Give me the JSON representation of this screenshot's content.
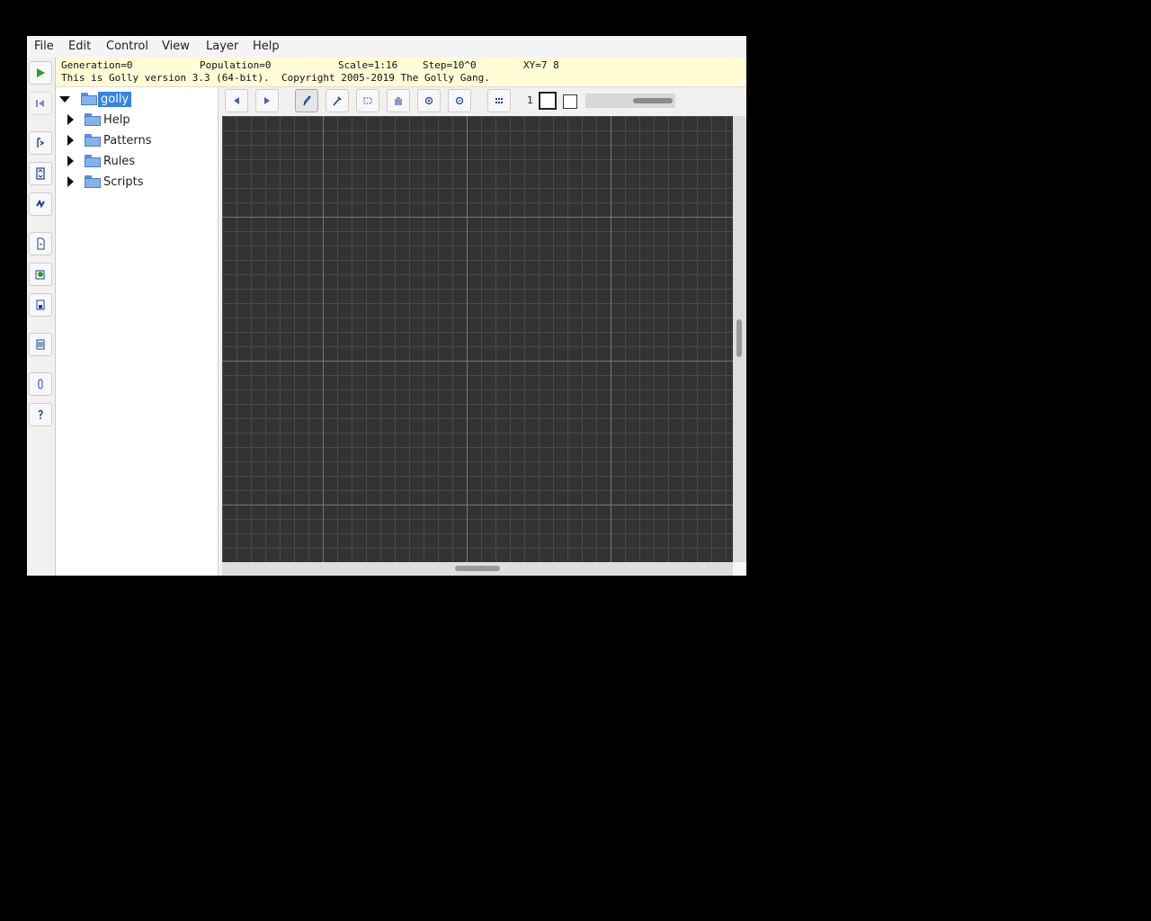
{
  "menubar": [
    "File",
    "Edit",
    "Control",
    "View",
    "Layer",
    "Help"
  ],
  "status": {
    "generation": "Generation=0",
    "population": "Population=0",
    "scale": "Scale=1:16",
    "step": "Step=10^0",
    "xy": "XY=7 8",
    "message": "This is Golly version 3.3 (64-bit).  Copyright 2005-2019 The Golly Gang."
  },
  "tree": {
    "root": "golly",
    "items": [
      "Help",
      "Patterns",
      "Rules",
      "Scripts"
    ]
  },
  "edit_toolbar": {
    "state_number": "1"
  },
  "colors": {
    "status_bg": "#fffcd6",
    "selection": "#3584e4",
    "grid_bg": "#333333",
    "play_green": "#2e9e2e",
    "icon_blue": "#1a3d9e"
  },
  "icons": {
    "left_toolbar": [
      "start-icon",
      "reset-icon",
      "stop-icon",
      "fit-icon",
      "hash-icon",
      "open-icon",
      "save-icon",
      "pattern-list-icon",
      "info-layer-icon",
      "info-icon",
      "help-icon"
    ],
    "edit_toolbar": [
      "undo-icon",
      "redo-icon",
      "draw-icon",
      "pick-icon",
      "select-icon",
      "move-icon",
      "zoom-in-icon",
      "zoom-out-icon",
      "all-states-icon"
    ]
  }
}
